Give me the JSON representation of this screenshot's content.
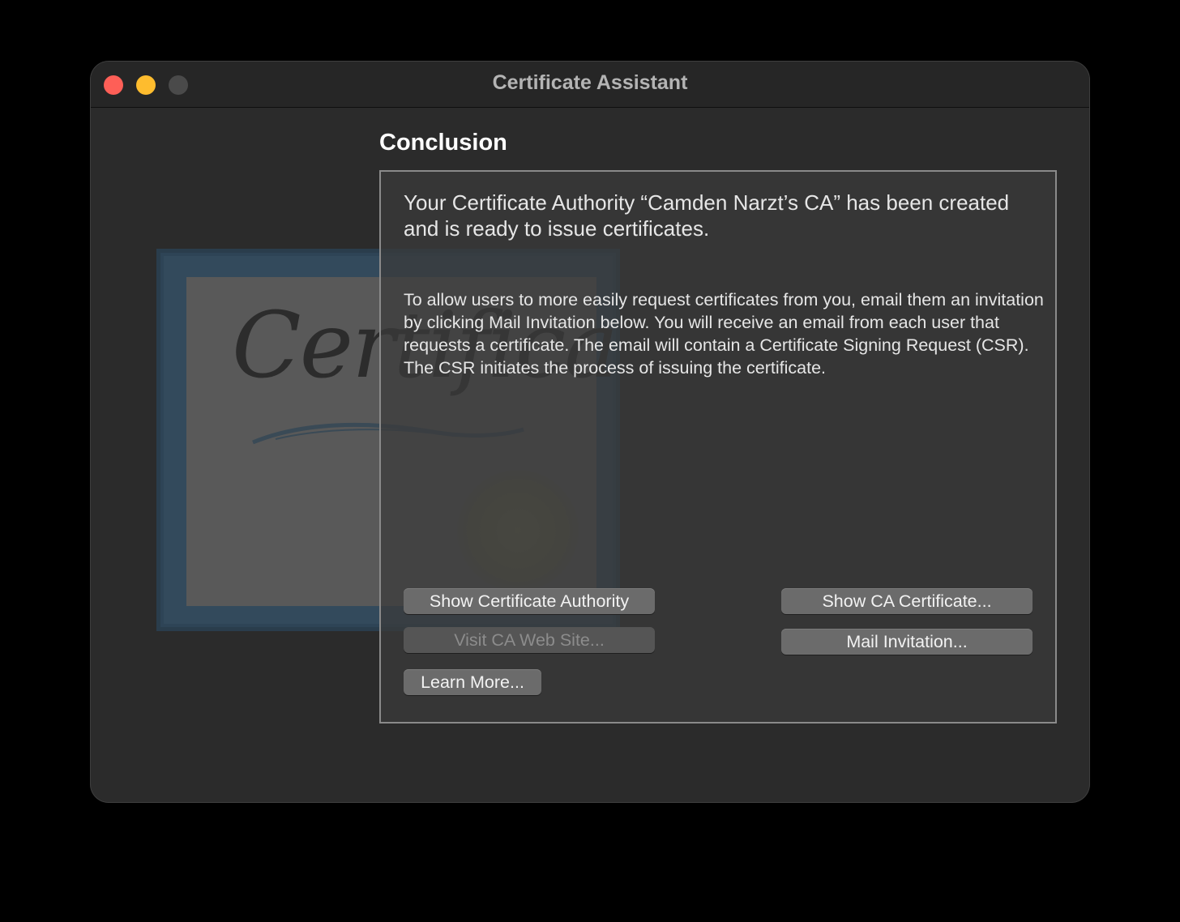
{
  "window": {
    "title": "Certificate Assistant"
  },
  "artwork": {
    "script_text": "Certificate"
  },
  "page": {
    "heading": "Conclusion",
    "headline": "Your Certificate Authority “Camden Narzt’s CA” has been created and is ready to issue certificates.",
    "body": "To allow users to more easily request certificates from you, email them an invitation by clicking Mail Invitation below. You will receive an email from each user that requests a certificate. The email will contain a Certificate Signing Request (CSR). The CSR initiates the process of issuing the certificate."
  },
  "buttons": {
    "show_ca_authority": "Show Certificate Authority",
    "visit_ca_site": "Visit CA Web Site...",
    "learn_more": "Learn More...",
    "show_ca_certificate": "Show CA Certificate...",
    "mail_invitation": "Mail Invitation..."
  },
  "colors": {
    "close": "#fe5f57",
    "minimize": "#febc2e",
    "zoom_disabled": "#4a4a4a",
    "window_bg": "#2b2b2b",
    "button_bg": "#6b6b6b"
  }
}
